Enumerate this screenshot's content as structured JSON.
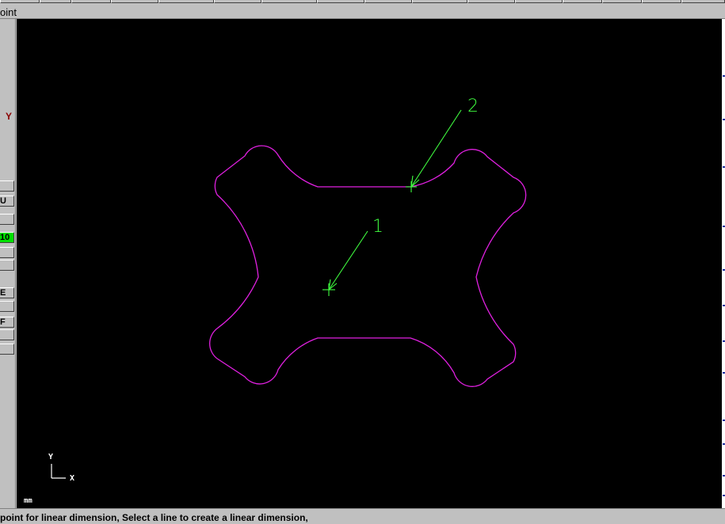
{
  "title_bar": {
    "text": "oint"
  },
  "left_panel": {
    "axis_label": "Y",
    "buttons": [
      {
        "label": ""
      },
      {
        "label": "U"
      },
      {
        "label": ""
      },
      {
        "label": "10",
        "active": true
      },
      {
        "label": ""
      },
      {
        "label": ""
      },
      {
        "label": "E"
      },
      {
        "label": ""
      },
      {
        "label": "F"
      },
      {
        "label": ""
      },
      {
        "label": ""
      }
    ]
  },
  "canvas": {
    "background": "#000000",
    "geometry_color": "#e020e0",
    "pick_color": "#40ff40",
    "pick_labels": [
      "1",
      "2"
    ],
    "ucs": {
      "y": "Y",
      "x": "X"
    },
    "units": "mm"
  },
  "status": {
    "prompt": "point for linear dimension, Select a line to create a linear dimension,"
  }
}
